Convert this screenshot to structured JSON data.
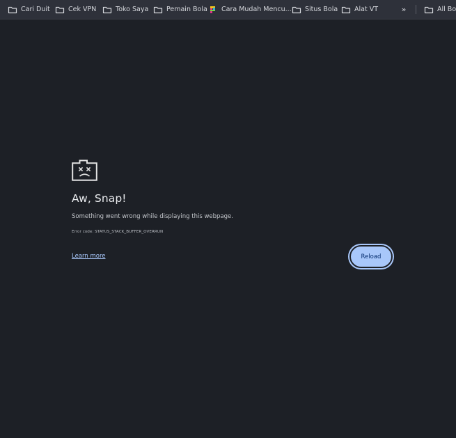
{
  "bookmarks_bar": {
    "items": [
      {
        "label": "Cari Duit",
        "icon": "folder-icon"
      },
      {
        "label": "Cek VPN",
        "icon": "folder-icon"
      },
      {
        "label": "Toko Saya",
        "icon": "folder-icon"
      },
      {
        "label": "Pemain Bola",
        "icon": "folder-icon"
      },
      {
        "label": "Cara Mudah Mencu...",
        "icon": "site-favicon-icon"
      },
      {
        "label": "Situs Bola",
        "icon": "folder-icon"
      },
      {
        "label": "Alat VT",
        "icon": "folder-icon"
      }
    ],
    "overflow_label": "»",
    "all_bookmarks_label": "All Bookmarks"
  },
  "error": {
    "icon": "sad-tab-icon",
    "title": "Aw, Snap!",
    "message": "Something went wrong while displaying this webpage.",
    "code": "Error code: STATUS_STACK_BUFFER_OVERRUN",
    "learn_more": "Learn more",
    "reload_label": "Reload"
  },
  "colors": {
    "background": "#1d2026",
    "bookmarks_bar": "#2e313a",
    "accent": "#a8c7fa",
    "button_text": "#062e6f"
  }
}
